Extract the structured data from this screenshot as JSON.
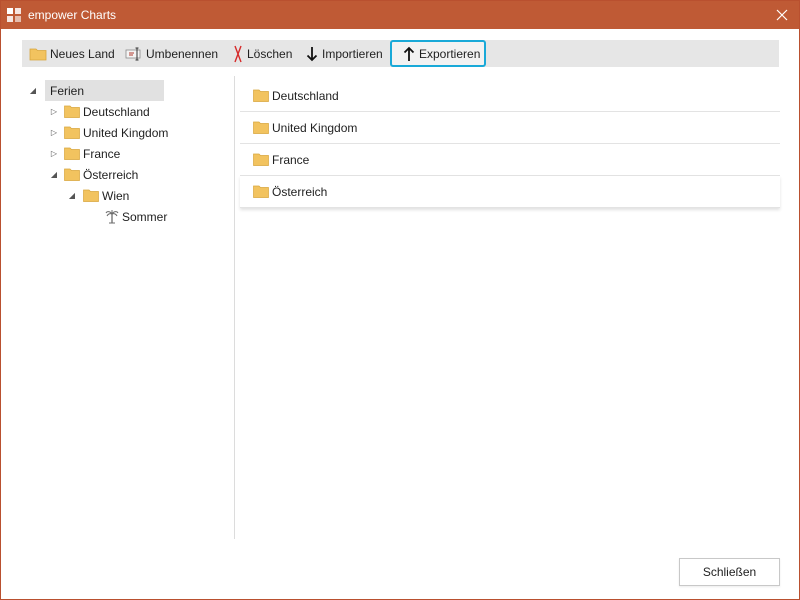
{
  "window": {
    "title": "empower Charts"
  },
  "toolbar": {
    "new_country": "Neues Land",
    "rename": "Umbenennen",
    "delete": "Löschen",
    "import": "Importieren",
    "export": "Exportieren"
  },
  "tree": {
    "root": "Ferien",
    "items": [
      {
        "label": "Deutschland"
      },
      {
        "label": "United Kingdom"
      },
      {
        "label": "France"
      },
      {
        "label": "Österreich"
      }
    ],
    "sub": {
      "label": "Wien"
    },
    "leaf": {
      "label": "Sommer"
    }
  },
  "list": {
    "items": [
      {
        "label": "Deutschland"
      },
      {
        "label": "United Kingdom"
      },
      {
        "label": "France"
      },
      {
        "label": "Österreich"
      }
    ]
  },
  "footer": {
    "close_label": "Schließen"
  },
  "colors": {
    "titlebar": "#bf5a35",
    "highlight": "#19a9d8",
    "folder": "#f2c35f"
  }
}
